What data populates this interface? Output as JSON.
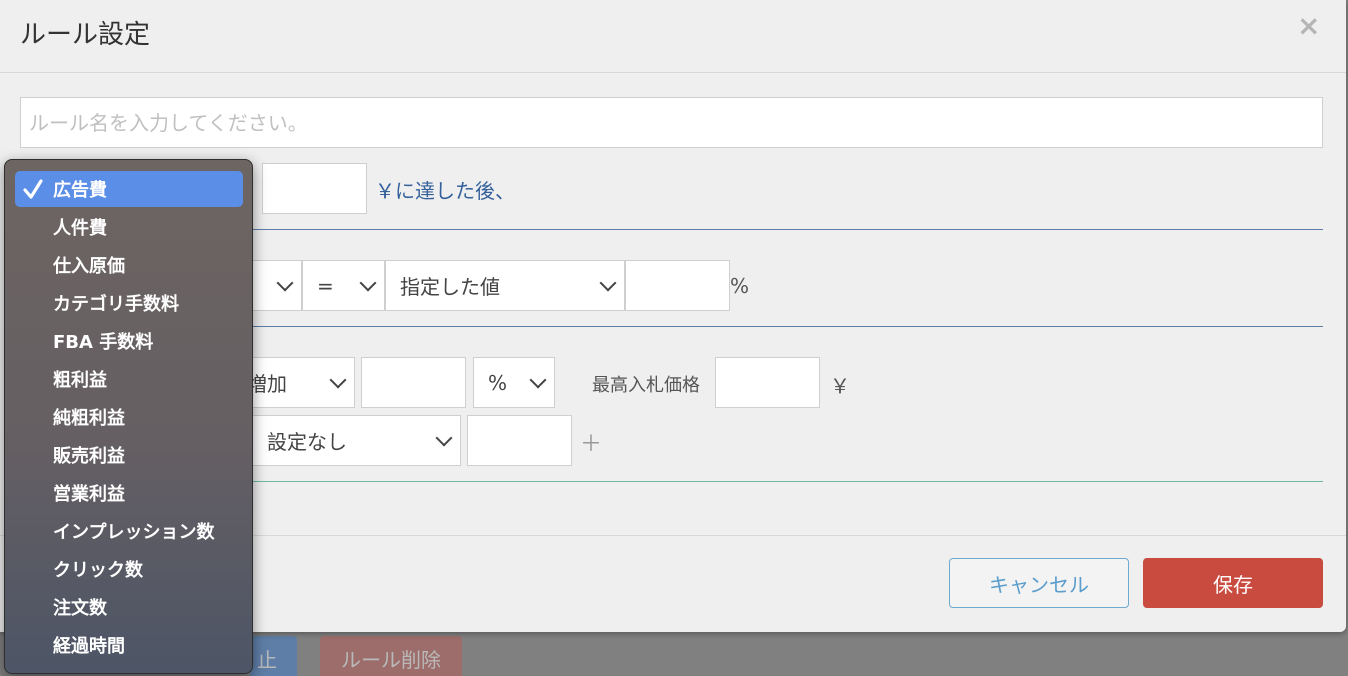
{
  "background": {
    "button_blue_label": "止",
    "button_red_label": "ルール削除"
  },
  "modal": {
    "title": "ルール設定",
    "close_symbol": "×",
    "rule_name_placeholder": "ルール名を入力してください。",
    "condition": {
      "amount_value": "",
      "suffix": "￥に達した後、"
    },
    "comparison": {
      "operator": "=",
      "target": "指定した値",
      "value": "",
      "unit": "%"
    },
    "action": {
      "adjust_type": "増加",
      "adjust_value": "",
      "adjust_unit": "%",
      "max_bid_label": "最高入札価格",
      "max_bid_value": "",
      "max_bid_unit": "￥",
      "extra_select": "設定なし",
      "extra_value": "",
      "add_symbol": "＋"
    },
    "footer": {
      "cancel_label": "キャンセル",
      "save_label": "保存"
    }
  },
  "dropdown": {
    "selected_index": 0,
    "items": [
      "広告費",
      "人件費",
      "仕入原価",
      "カテゴリ手数料",
      "FBA 手数料",
      "粗利益",
      "純粗利益",
      "販売利益",
      "営業利益",
      "インプレッション数",
      "クリック数",
      "注文数",
      "経過時間"
    ]
  },
  "colors": {
    "accent_blue": "#5b8ee6",
    "save_red": "#c94b40",
    "cancel_blue": "#5a9ccb",
    "divider_blue": "#5e7ea9",
    "divider_teal": "#6fb8a6"
  }
}
